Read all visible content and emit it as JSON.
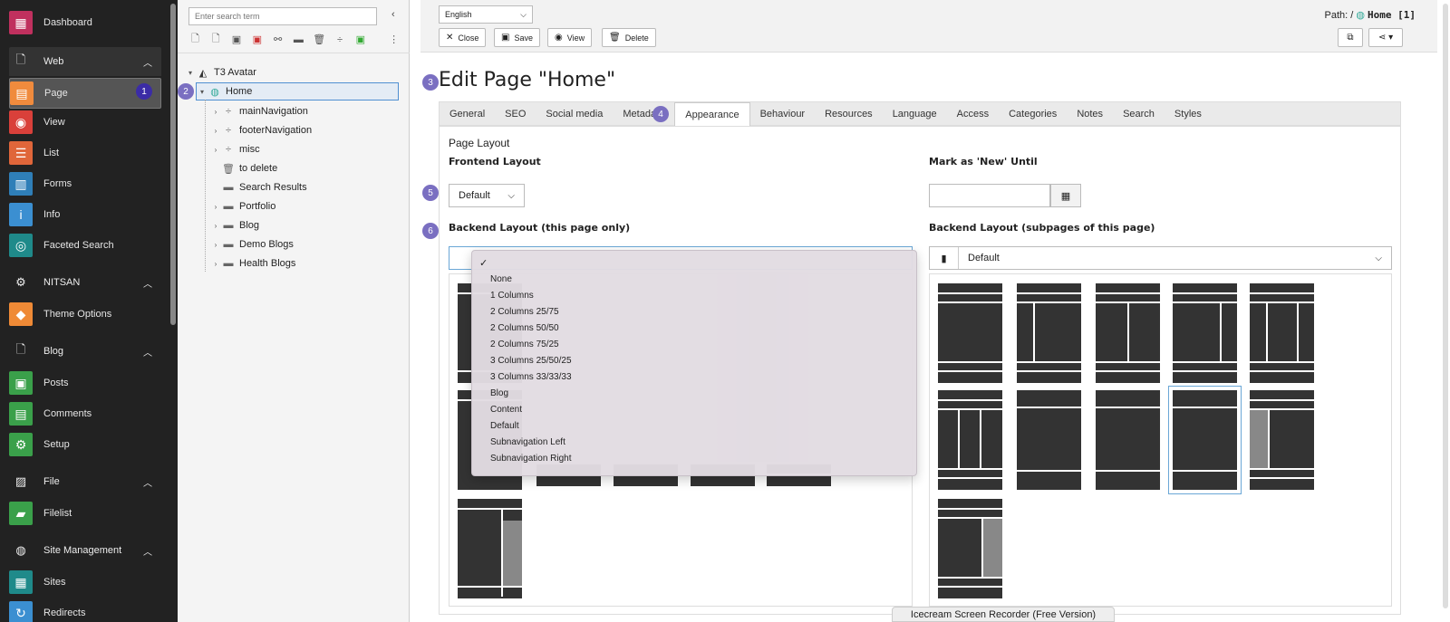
{
  "module_menu": {
    "dashboard": "Dashboard",
    "groups": [
      {
        "label": "Web",
        "items": [
          "Page",
          "View",
          "List",
          "Forms",
          "Info",
          "Faceted Search"
        ]
      },
      {
        "label": "NITSAN",
        "items": [
          "Theme Options"
        ]
      },
      {
        "label": "Blog",
        "items": [
          "Posts",
          "Comments",
          "Setup"
        ]
      },
      {
        "label": "File",
        "items": [
          "Filelist"
        ]
      },
      {
        "label": "Site Management",
        "items": [
          "Sites",
          "Redirects"
        ]
      }
    ],
    "page_badge": "1"
  },
  "tree": {
    "search_placeholder": "Enter search term",
    "root": "T3 Avatar",
    "home": "Home",
    "home_badge": "2",
    "children": [
      "mainNavigation",
      "footerNavigation",
      "misc",
      "to delete",
      "Search Results",
      "Portfolio",
      "Blog",
      "Demo Blogs",
      "Health Blogs"
    ]
  },
  "header": {
    "language": "English",
    "buttons": {
      "close": "Close",
      "save": "Save",
      "view": "View",
      "delete": "Delete"
    },
    "path_label": "Path: /",
    "path_page": "Home [1]"
  },
  "editor": {
    "title": "Edit Page \"Home\"",
    "title_badge": "3",
    "tabs": [
      "General",
      "SEO",
      "Social media",
      "Metadata",
      "Appearance",
      "Behaviour",
      "Resources",
      "Language",
      "Access",
      "Categories",
      "Notes",
      "Search",
      "Styles"
    ],
    "appearance_badge": "4",
    "section_title": "Page Layout",
    "frontend_layout_label": "Frontend Layout",
    "frontend_layout_value": "Default",
    "frontend_badge": "5",
    "mark_new_label": "Mark as 'New' Until",
    "backend_layout_label": "Backend Layout (this page only)",
    "backend_badge": "6",
    "backend_sub_label": "Backend Layout (subpages of this page)",
    "backend_sub_value": "Default"
  },
  "dropdown": {
    "check": "✓",
    "options": [
      "None",
      "1 Columns",
      "2 Columns 25/75",
      "2 Columns 50/50",
      "2 Columns 75/25",
      "3 Columns 25/50/25",
      "3 Columns 33/33/33",
      "Blog",
      "Content",
      "Default",
      "Subnavigation Left",
      "Subnavigation Right"
    ]
  },
  "recorder_label": "Icecream Screen Recorder (Free Version)",
  "colors": {
    "dashboard": "#c0305e",
    "page": "#f08b3d",
    "view": "#d9403a",
    "list": "#e0663a",
    "forms": "#2f7fb8",
    "info": "#3b8fd1",
    "faceted": "#1f8a8a",
    "theme": "#ef8a36",
    "posts": "#3aa04a",
    "comments": "#3aa04a",
    "setup": "#3aa04a",
    "filelist": "#3aa04a",
    "sites": "#1f8a8a",
    "redirects": "#3b8fd1",
    "badge": "#3b2ca6",
    "step_badge": "#7a6fc1"
  }
}
